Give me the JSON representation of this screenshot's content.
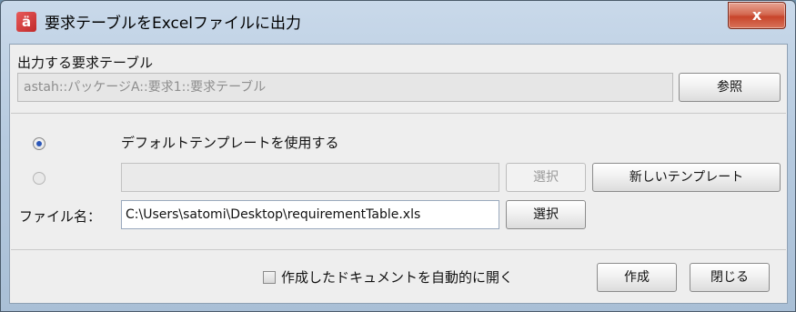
{
  "window": {
    "title": "要求テーブルをExcelファイルに出力",
    "icon_char": "ä",
    "close_glyph": "x"
  },
  "table_section": {
    "label": "出力する要求テーブル",
    "value": "astah::パッケージA::要求1::要求テーブル",
    "browse_label": "参照"
  },
  "template": {
    "default_option_label": "デフォルトテンプレートを使用する",
    "default_selected": true,
    "custom_path_value": "",
    "custom_select_label": "選択",
    "new_template_label": "新しいテンプレート"
  },
  "file": {
    "label": "ファイル名：",
    "value": "C:\\Users\\satomi\\Desktop\\requirementTable.xls",
    "select_label": "選択"
  },
  "footer": {
    "auto_open_label": "作成したドキュメントを自動的に開く",
    "auto_open_checked": false,
    "create_label": "作成",
    "close_label": "閉じる"
  }
}
